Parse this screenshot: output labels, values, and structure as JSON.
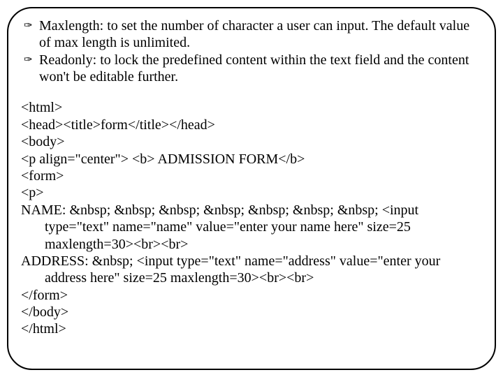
{
  "bullets": [
    {
      "icon": "✑",
      "text": "Maxlength: to set the number of character a user can input. The default value of max length is unlimited."
    },
    {
      "icon": "✑",
      "text": "Readonly: to lock the predefined content within the text field and the content won't be editable further."
    }
  ],
  "code": {
    "l1": "<html>",
    "l2": "<head><title>form</title></head>",
    "l3": "<body>",
    "l4": "<p align=\"center\"> <b> ADMISSION FORM</b>",
    "l5": "<form>",
    "l6": "<p>",
    "l7": "NAME: &nbsp; &nbsp; &nbsp; &nbsp; &nbsp; &nbsp; &nbsp; <input type=\"text\" name=\"name\" value=\"enter your name here\" size=25 maxlength=30><br><br>",
    "l8": "ADDRESS: &nbsp; <input type=\"text\" name=\"address\" value=\"enter your address here\" size=25 maxlength=30><br><br>",
    "l9": "</form>",
    "l10": "</body>",
    "l11": "</html>"
  }
}
